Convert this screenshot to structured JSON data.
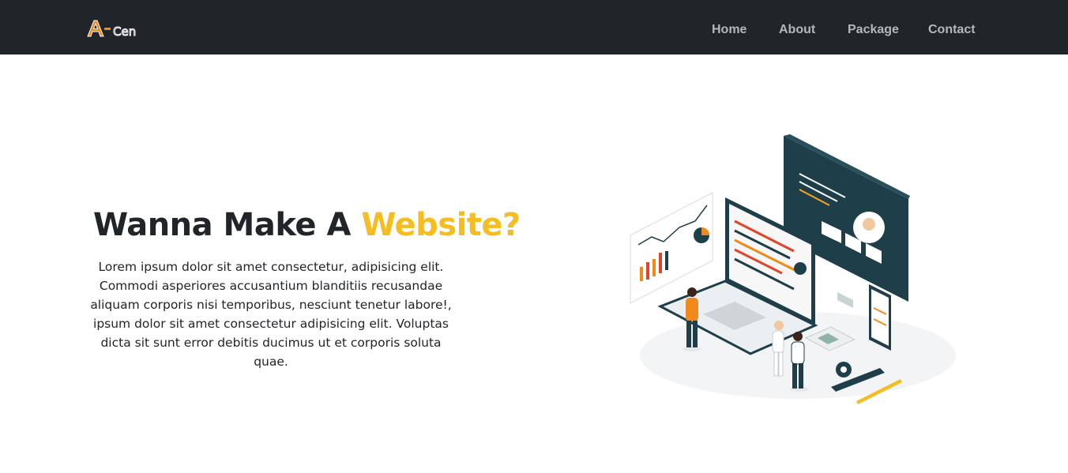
{
  "brand": {
    "logo_text": "A- Cen",
    "accent": "#f5bd1f",
    "logo_color": "#f08a1c",
    "nav_bg": "#212529"
  },
  "nav": {
    "items": [
      {
        "label": "Home"
      },
      {
        "label": "About"
      },
      {
        "label": "Package"
      },
      {
        "label": "Contact"
      }
    ]
  },
  "hero": {
    "title_main": "Wanna Make A ",
    "title_accent": "Website?",
    "body": "Lorem ipsum dolor sit amet consectetur, adipisicing elit. Commodi asperiores accusantium blanditiis recusandae aliquam corporis nisi temporibus, nesciunt tenetur labore!, ipsum dolor sit amet consectetur adipisicing elit. Voluptas dicta sit sunt error debitis ducimus ut et corporis soluta quae.",
    "illustration": "web-development-illustration"
  }
}
